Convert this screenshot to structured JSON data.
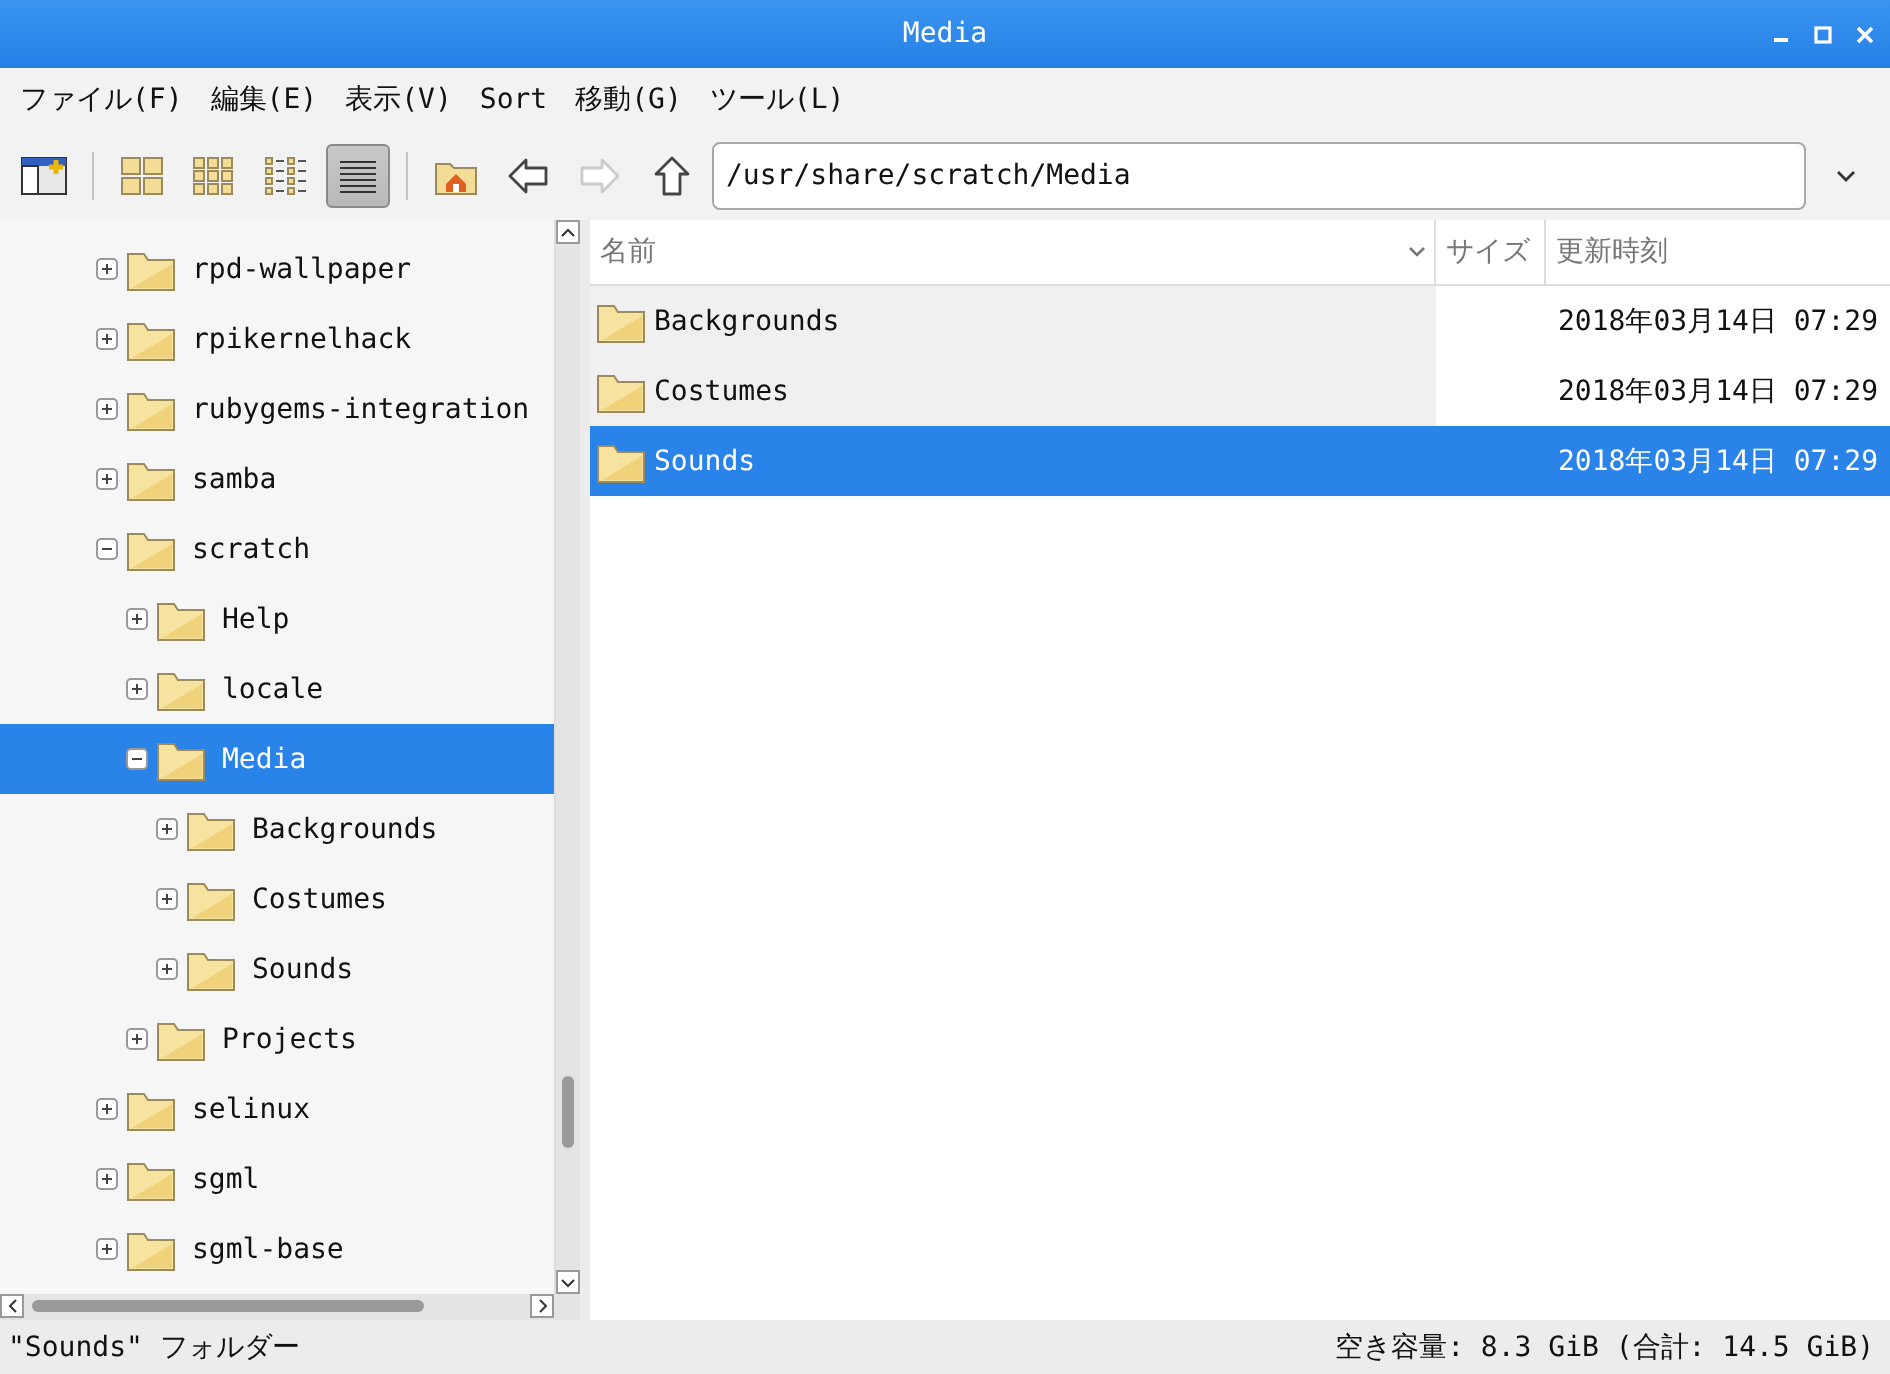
{
  "window": {
    "title": "Media"
  },
  "menu": [
    "ファイル(F)",
    "編集(E)",
    "表示(V)",
    "Sort",
    "移動(G)",
    "ツール(L)"
  ],
  "toolbar": {
    "view_modes": [
      {
        "kind": "icons",
        "selected": false
      },
      {
        "kind": "thumbnails",
        "selected": false
      },
      {
        "kind": "compact",
        "selected": false
      },
      {
        "kind": "list",
        "selected": true
      }
    ],
    "back": {
      "disabled": false
    },
    "forward": {
      "disabled": true
    },
    "up": {
      "disabled": false
    },
    "path": "/usr/share/scratch/Media"
  },
  "tree": [
    {
      "label": "rpd-wallpaper",
      "expanded": false,
      "selected": false
    },
    {
      "label": "rpikernelhack",
      "expanded": false,
      "selected": false
    },
    {
      "label": "rubygems-integration",
      "expanded": false,
      "selected": false
    },
    {
      "label": "samba",
      "expanded": false,
      "selected": false
    },
    {
      "label": "scratch",
      "expanded": true,
      "selected": false,
      "children": [
        {
          "label": "Help",
          "expanded": false,
          "selected": false
        },
        {
          "label": "locale",
          "expanded": false,
          "selected": false
        },
        {
          "label": "Media",
          "expanded": true,
          "selected": true,
          "children": [
            {
              "label": "Backgrounds",
              "expanded": false,
              "selected": false
            },
            {
              "label": "Costumes",
              "expanded": false,
              "selected": false
            },
            {
              "label": "Sounds",
              "expanded": false,
              "selected": false
            }
          ]
        },
        {
          "label": "Projects",
          "expanded": false,
          "selected": false
        }
      ]
    },
    {
      "label": "selinux",
      "expanded": false,
      "selected": false
    },
    {
      "label": "sgml",
      "expanded": false,
      "selected": false
    },
    {
      "label": "sgml-base",
      "expanded": false,
      "selected": false
    }
  ],
  "files": {
    "columns": [
      "名前",
      "サイズ",
      "更新時刻"
    ],
    "rows": [
      {
        "name": "Backgrounds",
        "size": "",
        "modified": "2018年03月14日 07:29",
        "selected": false
      },
      {
        "name": "Costumes",
        "size": "",
        "modified": "2018年03月14日 07:29",
        "selected": false
      },
      {
        "name": "Sounds",
        "size": "",
        "modified": "2018年03月14日 07:29",
        "selected": true
      }
    ]
  },
  "status_bar": {
    "selection": "\"Sounds\" フォルダー",
    "free_space": "空き容量: 8.3 GiB (合計: 14.5 GiB)"
  }
}
